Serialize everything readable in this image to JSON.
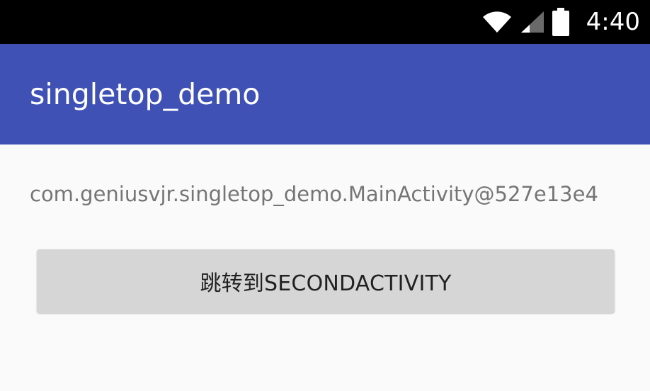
{
  "status_bar": {
    "time": "4:40",
    "icons": [
      "wifi-icon",
      "cell-signal-icon",
      "battery-icon"
    ]
  },
  "app_bar": {
    "title": "singletop_demo",
    "color": "#3f51b5"
  },
  "main": {
    "activity_text": "com.geniusvjr.singletop_demo.MainActivity@527e13e4",
    "button_label": "跳转到SECONDACTIVITY"
  },
  "colors": {
    "status_bar": "#000000",
    "primary": "#3f51b5",
    "background": "#fafafa",
    "button": "#d6d6d6",
    "text_secondary": "#757575"
  }
}
